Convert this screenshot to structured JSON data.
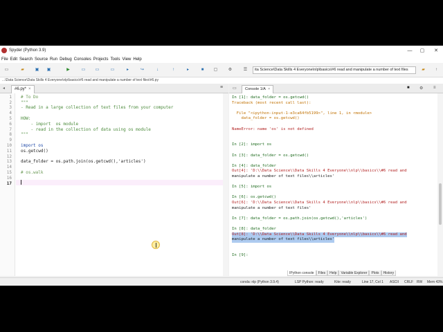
{
  "window": {
    "title": "Spyder (Python 3.9)",
    "controls": {
      "minimize": "—",
      "maximize": "▢",
      "close": "✕"
    }
  },
  "menu": [
    "File",
    "Edit",
    "Search",
    "Source",
    "Run",
    "Debug",
    "Consoles",
    "Projects",
    "Tools",
    "View",
    "Help"
  ],
  "toolbar": {
    "working_dir": "ita Science\\Data Skills 4 Everyone\\nlp\\basics\\#6 read and manipulate a number of text files"
  },
  "editor": {
    "file_path": "...\\Data Science\\Data Skills 4 Everyone\\nlp\\basics\\#6 read and manipulate a number of text files\\#6.py",
    "tab_label": "#6.py*",
    "tab_close": "×",
    "lines": [
      "# To Do",
      "\"\"\"",
      "- Read in a large collection of text files from your computer",
      "",
      "HOW:",
      "    - import  os module",
      "    - read in the collection of data using os module",
      "\"\"\"",
      "",
      "import os",
      "os.getcwd()",
      "",
      "data_folder = os.path.join(os.getcwd(),'articles')",
      "",
      "# os.walk",
      "",
      ""
    ],
    "line_numbers": [
      "1",
      "2",
      "3",
      "4",
      "5",
      "6",
      "7",
      "8",
      "9",
      "10",
      "11",
      "12",
      "13",
      "14",
      "15",
      "16",
      "17"
    ],
    "current_line": 17
  },
  "console": {
    "tab_label": "Console 1/A",
    "tab_close": "×",
    "lines": [
      "In [1]: data_folder = os.getcwd()",
      "Traceback (most recent call last):",
      "",
      "  File \"<ipython-input-1-e3ca64fb5199>\", line 1, in <module>",
      "    data_folder = os.getcwd()",
      "",
      "NameError: name 'os' is not defined",
      "",
      "",
      "In [2]: import os",
      "",
      "In [3]: data_folder = os.getcwd()",
      "",
      "In [4]: data_folder",
      "Out[4]: 'D:\\\\Data Science\\\\Data Skills 4 Everyone\\\\nlp\\\\basics\\\\#6 read and",
      "manipulate a number of text files\\\\articles'",
      "",
      "In [5]: import os",
      "",
      "In [6]: os.getcwd()",
      "Out[6]: 'D:\\\\Data Science\\\\Data Skills 4 Everyone\\\\nlp\\\\basics\\\\#6 read and",
      "manipulate a number of text files'",
      "",
      "In [7]: data_folder = os.path.join(os.getcwd(),'articles')",
      "",
      "In [8]: data_folder",
      "Out[8]: 'D:\\\\Data Science\\\\Data Skills 4 Everyone\\\\nlp\\\\basics\\\\#6 read and",
      "manipulate a number of text files\\\\articles'",
      "",
      "",
      "In [9]:"
    ],
    "pane_tabs": [
      "IPython console",
      "Files",
      "Help",
      "Variable Explorer",
      "Plots",
      "History"
    ]
  },
  "statusbar": {
    "conda": "conda: nlp (Python 3.9.4)",
    "lsp": "LSP Python: ready",
    "kite": "Kite: ready",
    "position": "Line 17, Col 1",
    "encoding": "ASCII",
    "eol": "CRLF",
    "perm": "RW",
    "mem": "Mem 43%"
  }
}
